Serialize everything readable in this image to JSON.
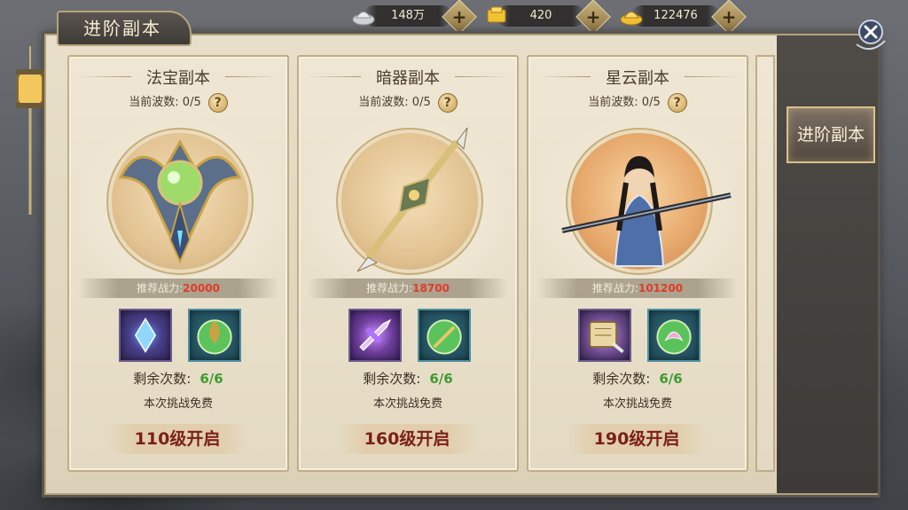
{
  "header": {
    "title": "进阶副本"
  },
  "resources": [
    {
      "name": "silver",
      "value": "148万",
      "icon": "silver-ingot-icon"
    },
    {
      "name": "gold",
      "value": "420",
      "icon": "gold-ingot-icon"
    },
    {
      "name": "bound-gold",
      "value": "122476",
      "icon": "gold-ingot-icon"
    }
  ],
  "side_tab": {
    "label": "进阶副本"
  },
  "cards": [
    {
      "title": "法宝副本",
      "wave_label": "当前波数: 0/5",
      "help": "?",
      "power_label": "推荐战力:",
      "power_value": "20000",
      "remain_label": "剩余次数:",
      "remain_value": "6/6",
      "free_text": "本次挑战免费",
      "unlock_text": "110级开启"
    },
    {
      "title": "暗器副本",
      "wave_label": "当前波数: 0/5",
      "help": "?",
      "power_label": "推荐战力:",
      "power_value": "18700",
      "remain_label": "剩余次数:",
      "remain_value": "6/6",
      "free_text": "本次挑战免费",
      "unlock_text": "160级开启"
    },
    {
      "title": "星云副本",
      "wave_label": "当前波数: 0/5",
      "help": "?",
      "power_label": "推荐战力:",
      "power_value": "101200",
      "remain_label": "剩余次数:",
      "remain_value": "6/6",
      "free_text": "本次挑战免费",
      "unlock_text": "190级开启"
    }
  ],
  "colors": {
    "power_value": "#e23a2a",
    "remain_value": "#3f9a32",
    "unlock_text": "#7a1f18",
    "gold_accent": "#c9b17a"
  }
}
